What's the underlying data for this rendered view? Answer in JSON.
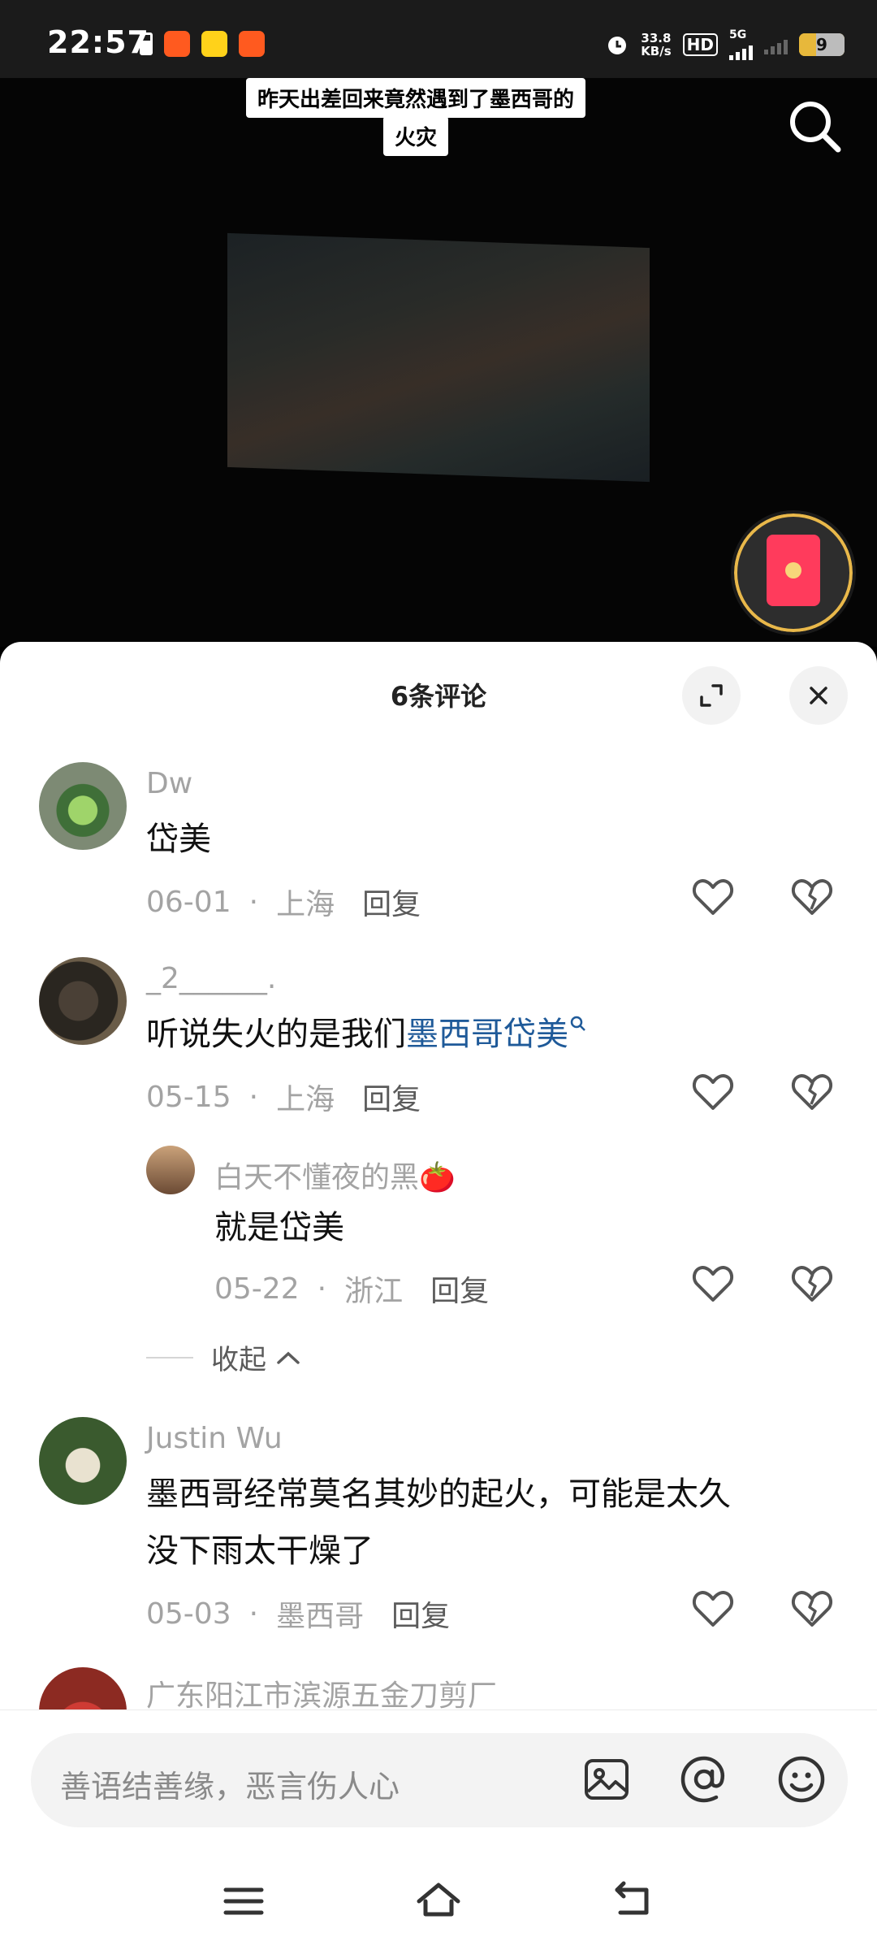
{
  "status_bar": {
    "time": "22:57",
    "net_speed_top": "33.8",
    "net_speed_unit": "KB/s",
    "hd_label": "HD",
    "network": "5G",
    "battery": "9"
  },
  "video": {
    "caption_line1": "昨天出差回来竟然遇到了墨西哥的",
    "caption_line2": "火灾"
  },
  "sheet": {
    "title": "6条评论"
  },
  "comments": [
    {
      "user": "Dw",
      "text": "岱美",
      "date": "06-01",
      "location": "上海",
      "reply": "回复"
    },
    {
      "user": "_2______.",
      "text_prefix": "听说失火的是我们",
      "text_link": "墨西哥岱美",
      "date": "05-15",
      "location": "上海",
      "reply": "回复"
    },
    {
      "user": "白天不懂夜的黑🍅",
      "text": "就是岱美",
      "date": "05-22",
      "location": "浙江",
      "reply": "回复"
    },
    {
      "user": "Justin Wu",
      "text_line1": "墨西哥经常莫名其妙的起火，可能是太久",
      "text_line2": "没下雨太干燥了",
      "date": "05-03",
      "location": "墨西哥",
      "reply": "回复"
    },
    {
      "user": "广东阳江市滨源五金刀剪厂"
    }
  ],
  "collapse_label": "收起",
  "input": {
    "placeholder": "善语结善缘，恶言伤人心"
  },
  "icons": {
    "search": "search-icon",
    "expand": "expand-icon",
    "close": "close-icon",
    "like": "heart-icon",
    "dislike": "broken-heart-icon",
    "image": "image-icon",
    "mention": "at-icon",
    "emoji": "emoji-icon",
    "menu": "menu-icon",
    "home": "home-icon",
    "back": "back-icon"
  }
}
